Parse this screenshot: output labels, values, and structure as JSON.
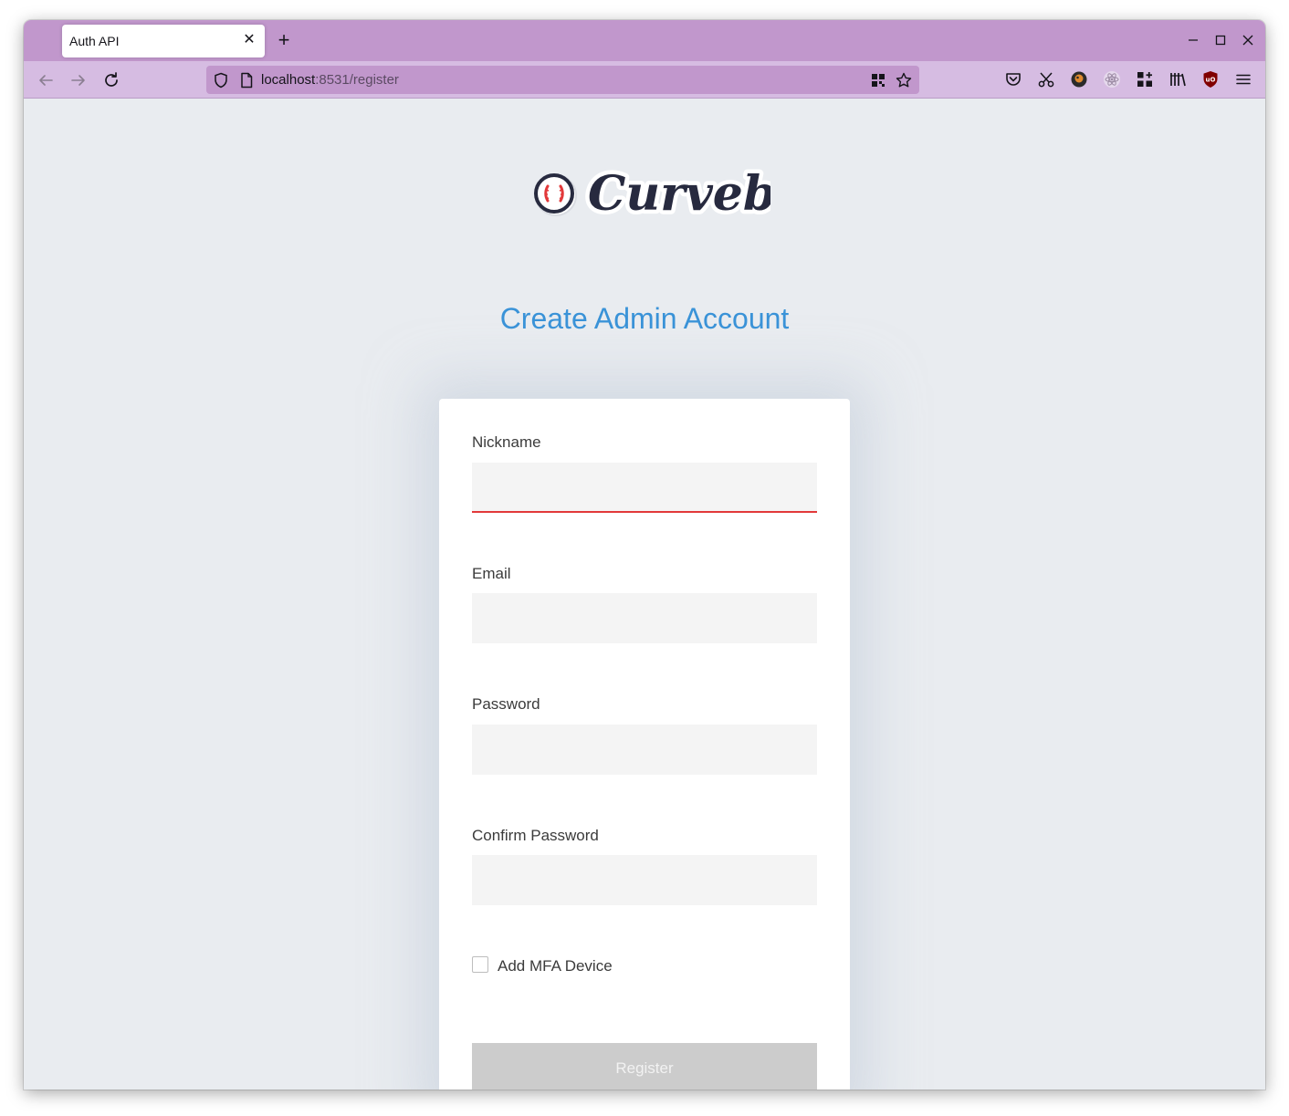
{
  "browser": {
    "tab_title": "Auth API",
    "tab_close": "✕",
    "new_tab": "+",
    "url_host": "localhost",
    "url_rest": ":8531/register"
  },
  "page": {
    "logo_text": "Curveball",
    "heading": "Create Admin Account",
    "form": {
      "nickname_label": "Nickname",
      "nickname_value": "",
      "email_label": "Email",
      "email_value": "",
      "password_label": "Password",
      "password_value": "",
      "confirm_label": "Confirm Password",
      "confirm_value": "",
      "mfa_label": "Add MFA Device",
      "mfa_checked": false,
      "register_label": "Register"
    }
  },
  "colors": {
    "tabbar": "#c197cc",
    "navbar": "#d6bce2",
    "heading": "#3a93d8",
    "error_underline": "#e2393a",
    "button_disabled": "#cccccc"
  }
}
